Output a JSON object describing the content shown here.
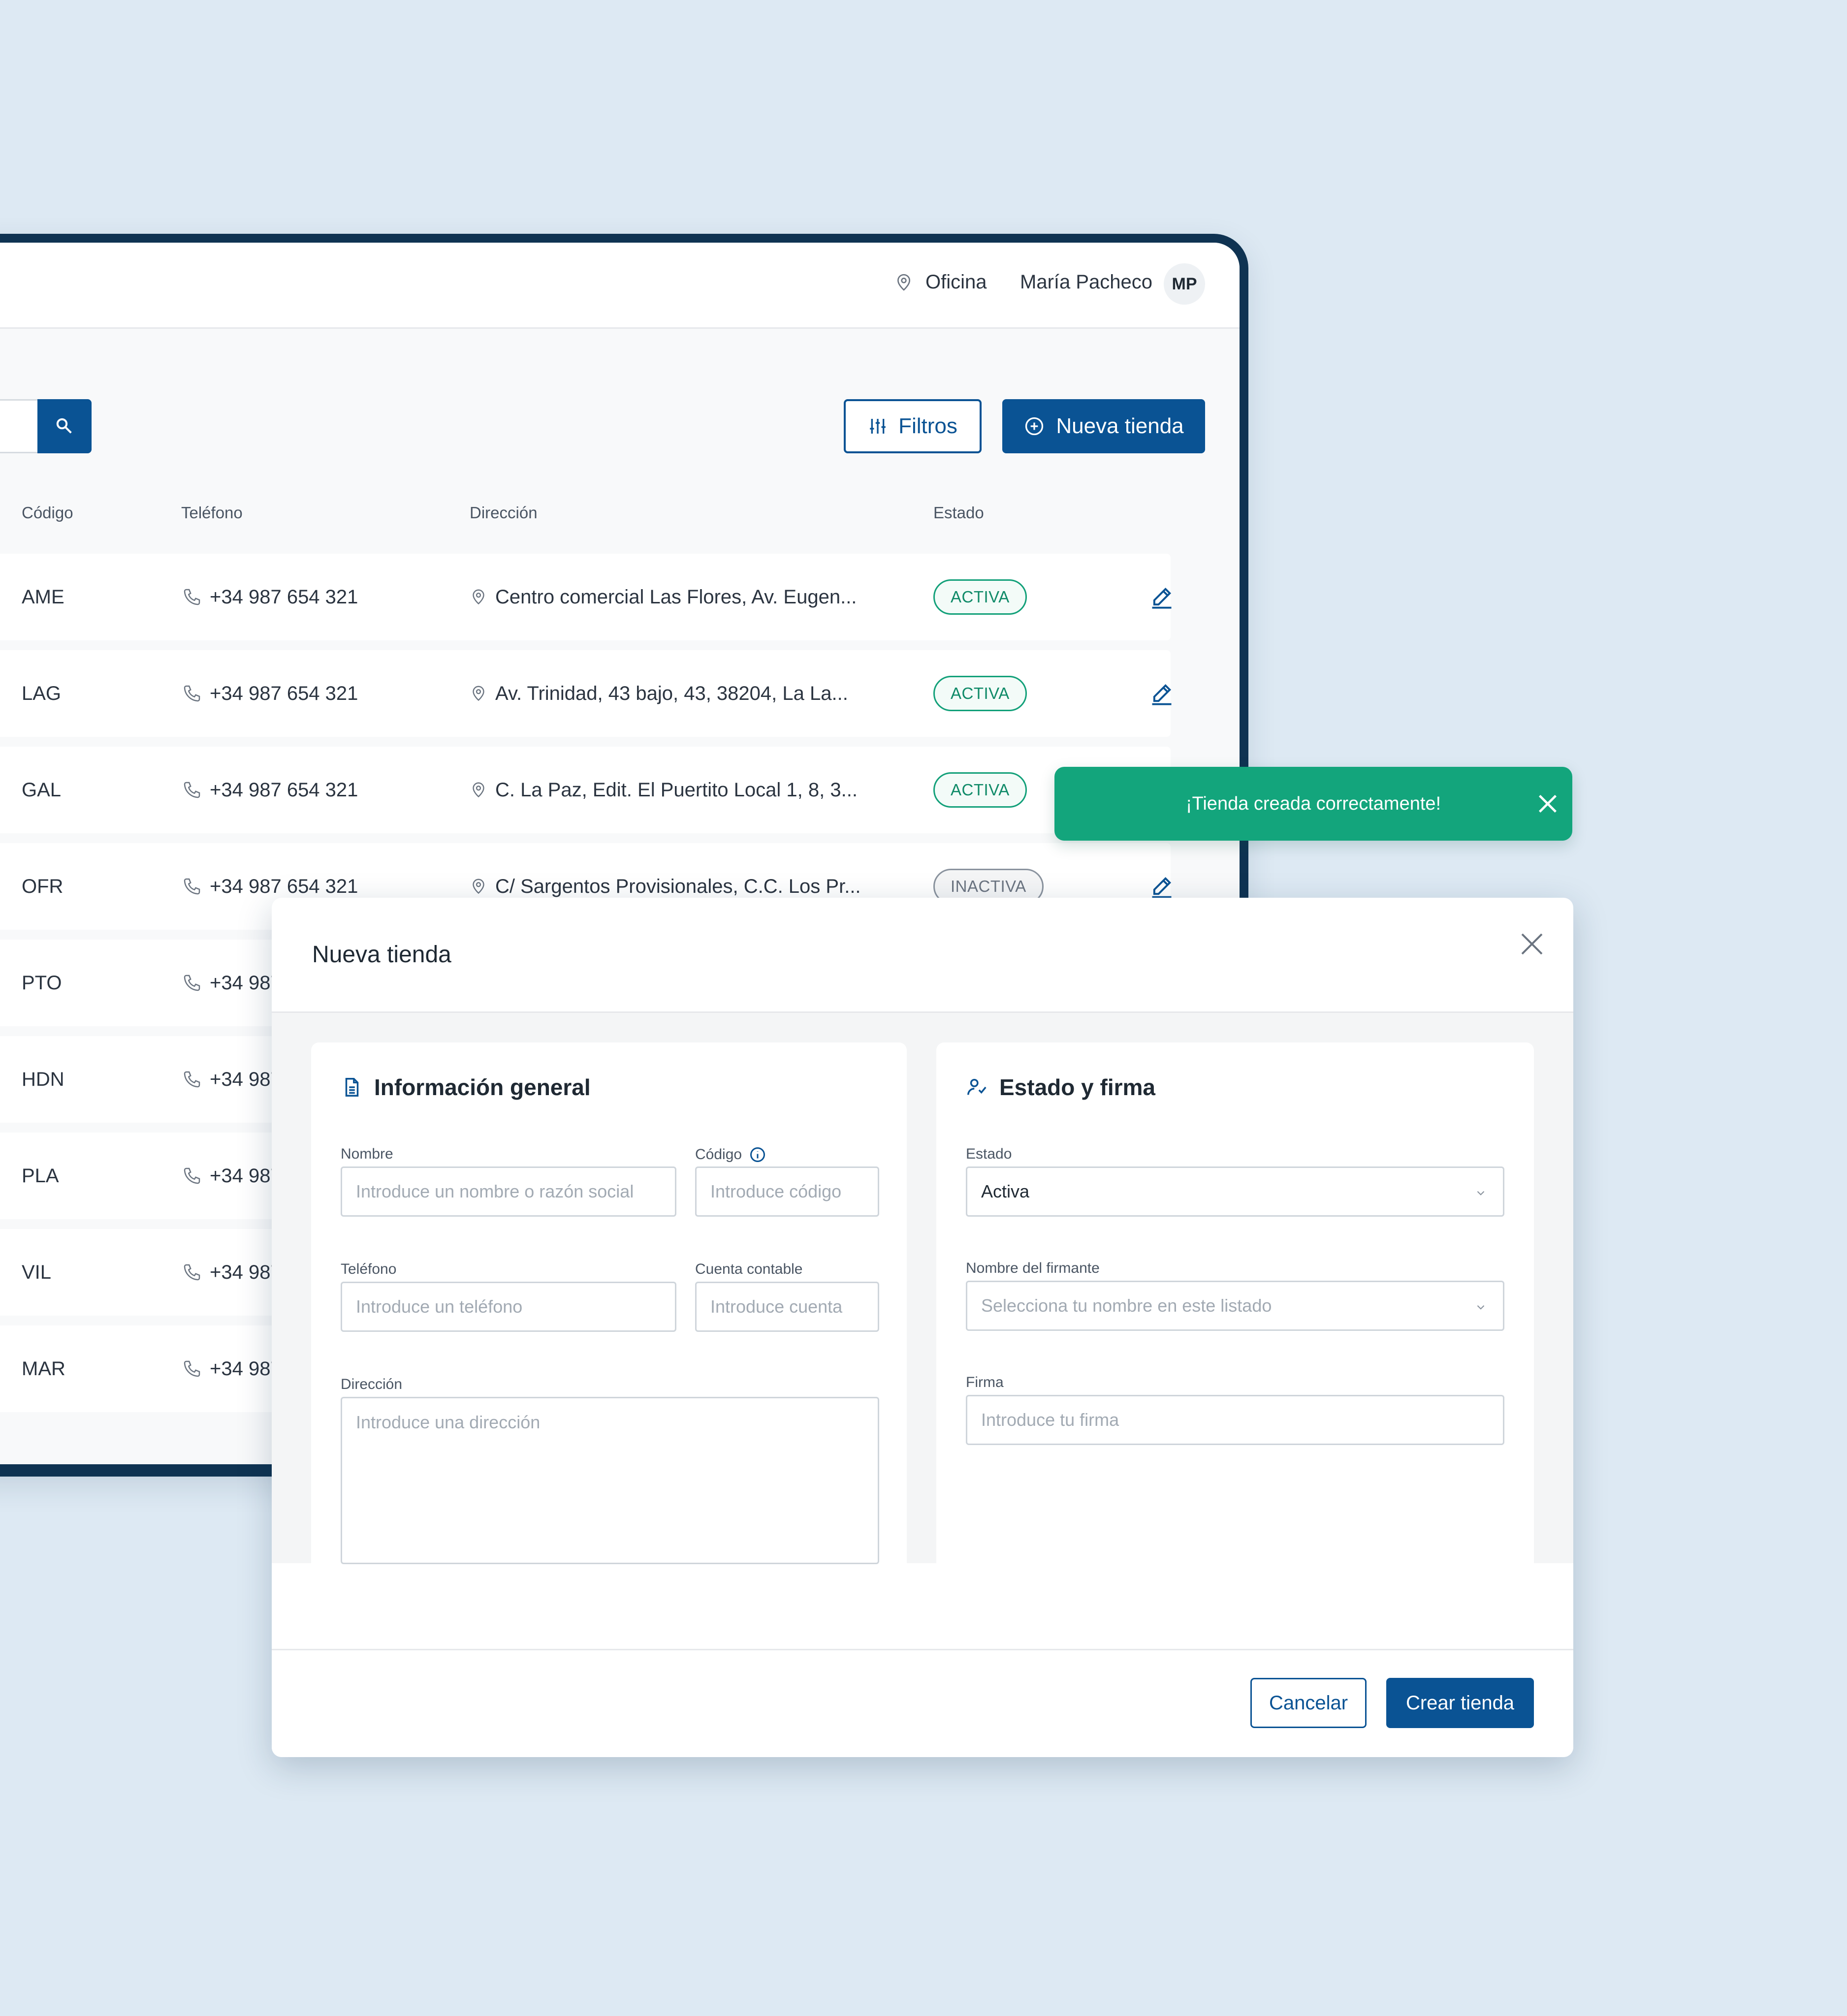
{
  "header": {
    "office_label": "Oficina",
    "user_name": "María Pacheco",
    "user_initials": "MP"
  },
  "toolbar": {
    "filters_label": "Filtros",
    "new_store_label": "Nueva tienda"
  },
  "table": {
    "columns": {
      "code": "Código",
      "phone": "Teléfono",
      "address": "Dirección",
      "status": "Estado"
    },
    "rows": [
      {
        "code": "AME",
        "phone": "+34 987 654 321",
        "address": "Centro comercial Las Flores, Av. Eugen...",
        "status": "ACTIVA"
      },
      {
        "code": "LAG",
        "phone": "+34 987 654 321",
        "address": "Av. Trinidad, 43 bajo, 43, 38204, La La...",
        "status": "ACTIVA"
      },
      {
        "code": "GAL",
        "phone": "+34 987 654 321",
        "address": "C. La Paz, Edit. El Puertito Local 1, 8, 3...",
        "status": "ACTIVA"
      },
      {
        "code": "OFR",
        "phone": "+34 987 654 321",
        "address": "C/ Sargentos Provisionales, C.C. Los Pr...",
        "status": "INACTIVA"
      },
      {
        "code": "PTO",
        "phone": "+34 987"
      },
      {
        "code": "HDN",
        "phone": "+34 987"
      },
      {
        "code": "PLA",
        "phone": "+34 987"
      },
      {
        "code": "VIL",
        "phone": "+34 987"
      },
      {
        "code": "MAR",
        "phone": "+34 987"
      }
    ]
  },
  "toast": {
    "message": "¡Tienda creada correctamente!"
  },
  "modal": {
    "title": "Nueva tienda",
    "general": {
      "title": "Información general",
      "name_label": "Nombre",
      "name_placeholder": "Introduce un nombre o razón social",
      "code_label": "Código",
      "code_placeholder": "Introduce código",
      "phone_label": "Teléfono",
      "phone_placeholder": "Introduce un teléfono",
      "account_label": "Cuenta contable",
      "account_placeholder": "Introduce cuenta",
      "address_label": "Dirección",
      "address_placeholder": "Introduce una dirección"
    },
    "status_sign": {
      "title": "Estado y firma",
      "status_label": "Estado",
      "status_value": "Activa",
      "signer_label": "Nombre del firmante",
      "signer_placeholder": "Selecciona tu nombre en este listado",
      "signature_label": "Firma",
      "signature_placeholder": "Introduce tu firma"
    },
    "cancel_label": "Cancelar",
    "create_label": "Crear tienda"
  },
  "colors": {
    "primary": "#0a5394",
    "success": "#13a57c",
    "frame": "#0f3352",
    "background": "#dde9f3"
  }
}
